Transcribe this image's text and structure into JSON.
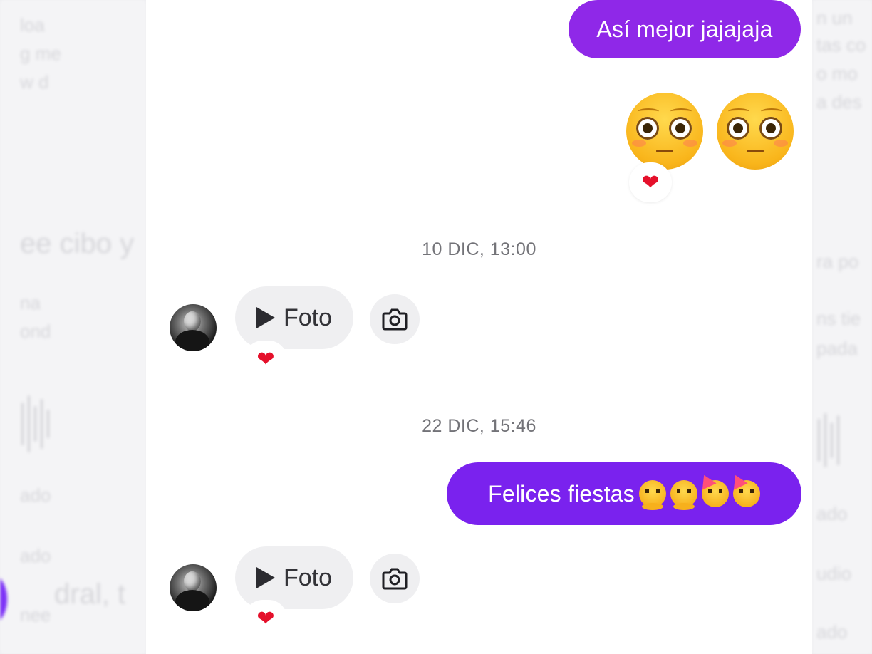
{
  "background_ghost": {
    "left_lines": [
      "loa",
      "g me",
      "w d",
      "ee cibo y",
      "na",
      "ond",
      "ado",
      "ado",
      "dral, t",
      "nee"
    ],
    "right_lines": [
      "n un",
      "tas co",
      "o mo",
      "a des",
      "ra po",
      "ns tie",
      "pada",
      "ado",
      "udio",
      "ado"
    ]
  },
  "messages": {
    "sent_1": {
      "text": "Así mejor jajajaja"
    },
    "emoji_message": {
      "emoji_name": "flushed-face",
      "count": 2,
      "reaction": "❤"
    },
    "timestamp_1": "10 DIC, 13:00",
    "received_1": {
      "label": "Foto",
      "reaction": "❤",
      "camera_icon": "camera-icon"
    },
    "timestamp_2": "22 DIC, 15:46",
    "sent_2": {
      "text": "Felices fiestas",
      "emoji_names": [
        "melting-face",
        "melting-face",
        "partying-face",
        "partying-face"
      ]
    },
    "received_2": {
      "label": "Foto",
      "reaction": "❤",
      "camera_icon": "camera-icon"
    }
  },
  "colors": {
    "sent_bubble": "#8f28e8",
    "sent_bubble_2": "#7a22ee",
    "reaction_heart": "#e5102b",
    "timestamp_text": "#737378"
  }
}
